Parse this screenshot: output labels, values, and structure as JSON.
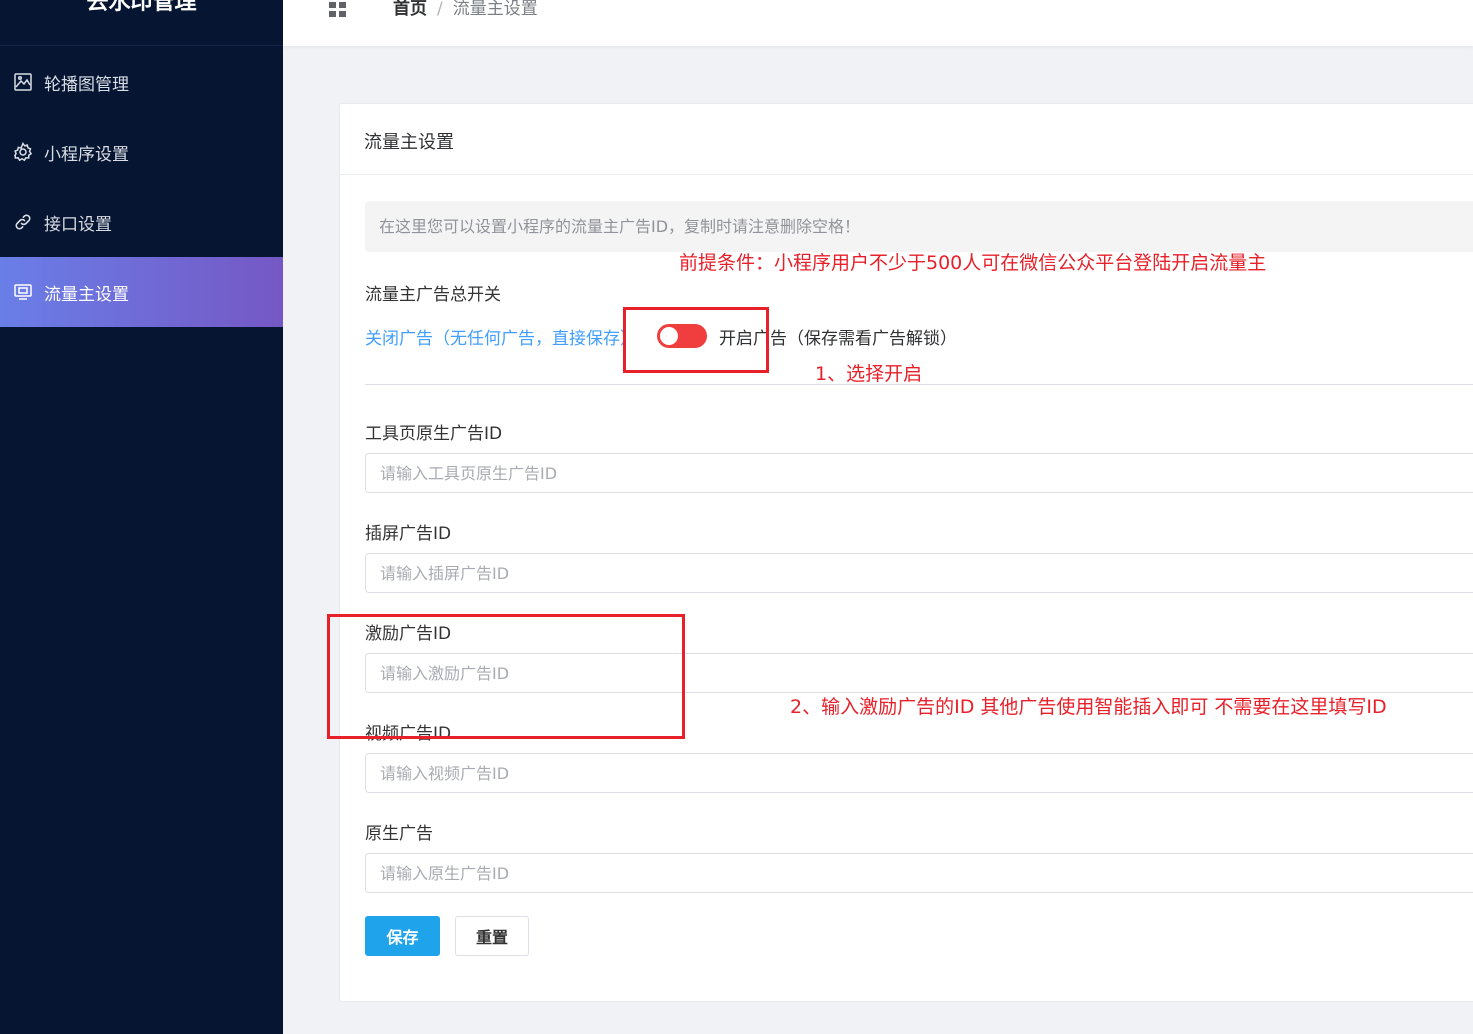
{
  "sidebar": {
    "logo": "去水印管理",
    "items": [
      {
        "label": "轮播图管理",
        "icon": "image-icon"
      },
      {
        "label": "小程序设置",
        "icon": "gear-icon"
      },
      {
        "label": "接口设置",
        "icon": "link-icon"
      },
      {
        "label": "流量主设置",
        "icon": "screen-icon",
        "active": true
      }
    ]
  },
  "header": {
    "breadcrumb": {
      "home": "首页",
      "separator": "/",
      "current": "流量主设置"
    }
  },
  "card": {
    "title": "流量主设置",
    "notice": "在这里您可以设置小程序的流量主广告ID，复制时请注意删除空格！"
  },
  "form": {
    "switch_label": "流量主广告总开关",
    "switch_off_text": "关闭广告（无任何广告，直接保存）",
    "switch_on_text": "开启广告（保存需看广告解锁）",
    "fields": [
      {
        "label": "工具页原生广告ID",
        "placeholder": "请输入工具页原生广告ID"
      },
      {
        "label": "插屏广告ID",
        "placeholder": "请输入插屏广告ID"
      },
      {
        "label": "激励广告ID",
        "placeholder": "请输入激励广告ID"
      },
      {
        "label": "视频广告ID",
        "placeholder": "请输入视频广告ID"
      },
      {
        "label": "原生广告",
        "placeholder": "请输入原生广告ID"
      }
    ],
    "save_label": "保存",
    "reset_label": "重置"
  },
  "annotations": {
    "precondition": "前提条件：小程序用户不少于500人可在微信公众平台登陆开启流量主",
    "step1": "1、选择开启",
    "step2": "2、输入激励广告的ID 其他广告使用智能插入即可 不需要在这里填写ID"
  },
  "colors": {
    "sidebar_bg": "#061531",
    "active_gradient_start": "#6a7ee8",
    "active_gradient_end": "#7558c4",
    "switch_active": "#f03e3e",
    "link_blue": "#409eff",
    "save_button": "#1fa4ec",
    "annotation_red": "#e8202a"
  }
}
